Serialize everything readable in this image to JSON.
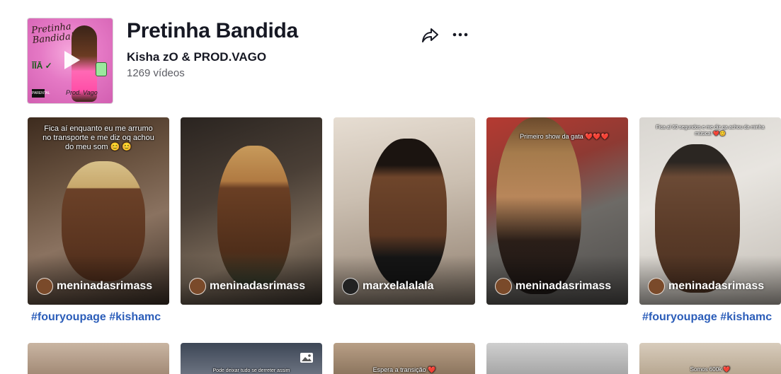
{
  "playlist": {
    "title": "Pretinha Bandida",
    "artist": "Kisha zO & PROD.VAGO",
    "video_count": "1269 vídeos",
    "cover_art_text": "Pretinha Bandida!"
  },
  "actions": {
    "share_icon": "share-arrow-icon",
    "more_icon": "more-dots-icon"
  },
  "colors": {
    "hashtag": "#2b5db9",
    "title": "#161823",
    "subtext": "#5b5c63"
  },
  "videos": [
    {
      "caption": "Fica aí enquanto eu me arrumo no transporte e me diz oq achou do meu som 😊 😊",
      "username": "meninadasrimass",
      "hashtag": "#fouryoupage #kishamc"
    },
    {
      "caption": "",
      "username": "meninadasrimass",
      "hashtag": ""
    },
    {
      "caption": "",
      "username": "marxelalalala",
      "hashtag": ""
    },
    {
      "caption": "Primeiro show da gata ❤️❤️❤️",
      "username": "meninadasrimass",
      "hashtag": ""
    },
    {
      "caption": "Fica aí 60 segundos e me diz qa achou da minha música! ❤️😊",
      "username": "meninadasrimass",
      "hashtag": "#fouryoupage #kishamc"
    }
  ],
  "videos_row2": [
    {
      "caption": ""
    },
    {
      "caption": "Pode deixar tudo se derreter assim"
    },
    {
      "caption": "Espera a transição ❤️"
    },
    {
      "caption": ""
    },
    {
      "caption": "Somos 600k ❤️"
    }
  ]
}
